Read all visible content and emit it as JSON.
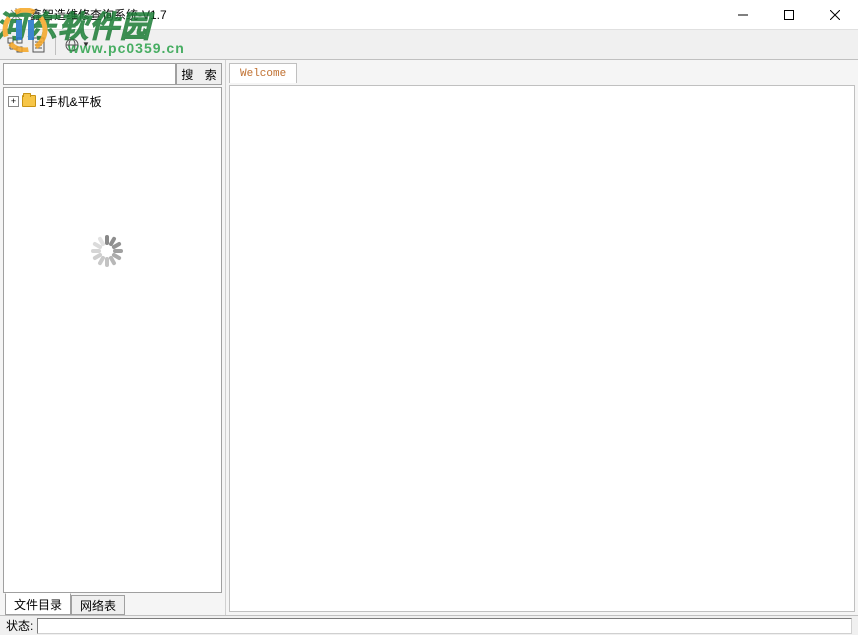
{
  "window": {
    "title": "鑫智造维修查询系统-V1.7"
  },
  "sidebar": {
    "search_button": "搜 索",
    "tree": {
      "item0": {
        "label": "1手机&平板"
      }
    },
    "tabs": {
      "file_dir": "文件目录",
      "net_table": "网络表"
    }
  },
  "content": {
    "tabs": {
      "welcome": "Welcome"
    }
  },
  "statusbar": {
    "label": "状态:"
  },
  "watermark": {
    "text": "河东软件园",
    "url": "www.pc0359.cn"
  }
}
